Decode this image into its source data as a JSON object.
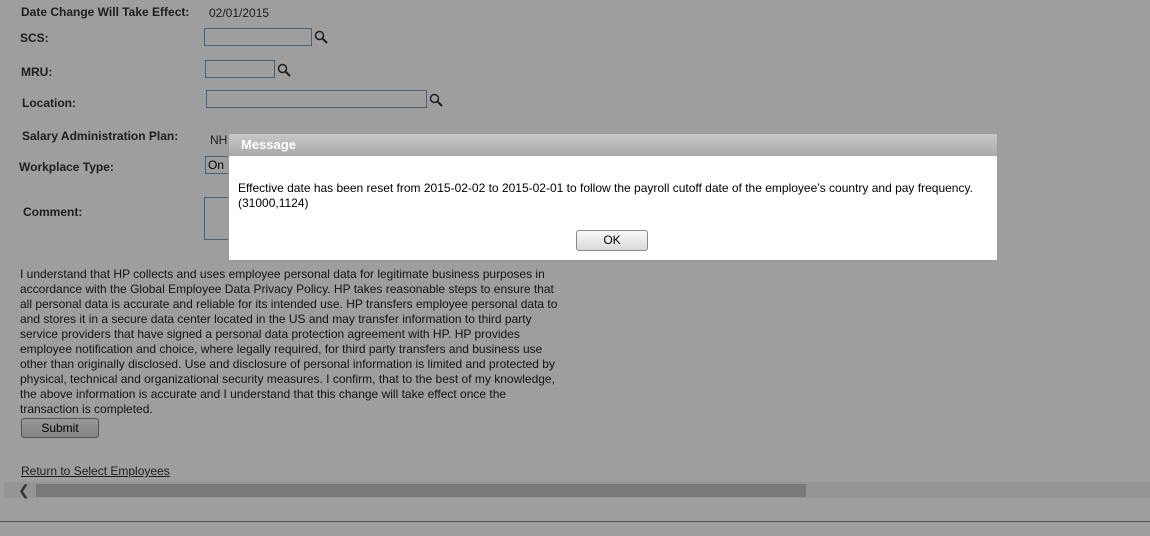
{
  "form": {
    "effective_label": "Date Change Will Take Effect:",
    "effective_value": "02/01/2015",
    "scs_label": "SCS:",
    "mru_label": "MRU:",
    "location_label": "Location:",
    "salary_plan_label": "Salary Administration Plan:",
    "salary_plan_value": "NH",
    "workplace_label": "Workplace Type:",
    "workplace_value": "On",
    "comment_label": "Comment:"
  },
  "consent_text": "I understand that HP collects and uses employee personal data for legitimate business purposes in accordance with the Global Employee Data Privacy Policy. HP takes reasonable steps to ensure that all personal data is accurate and reliable for its intended use. HP transfers employee personal data to and stores it in a secure data center located in the US and may transfer information to third party service providers that have signed a personal data protection agreement with HP. HP provides employee notification and choice, where legally required, for third party transfers and business use other than originally disclosed. Use and disclosure of personal information is limited and protected by physical, technical and organizational security measures. I confirm, that to the best of my knowledge, the above information is accurate and I understand that this change will take effect once the transaction is completed.",
  "submit_label": "Submit",
  "return_link": "Return to Select Employees",
  "dialog": {
    "title": "Message",
    "message": "Effective date has been reset from 2015-02-02 to 2015-02-01 to follow the payroll cutoff date of the employee’s country and pay frequency. (31000,1124)",
    "ok_label": "OK"
  }
}
